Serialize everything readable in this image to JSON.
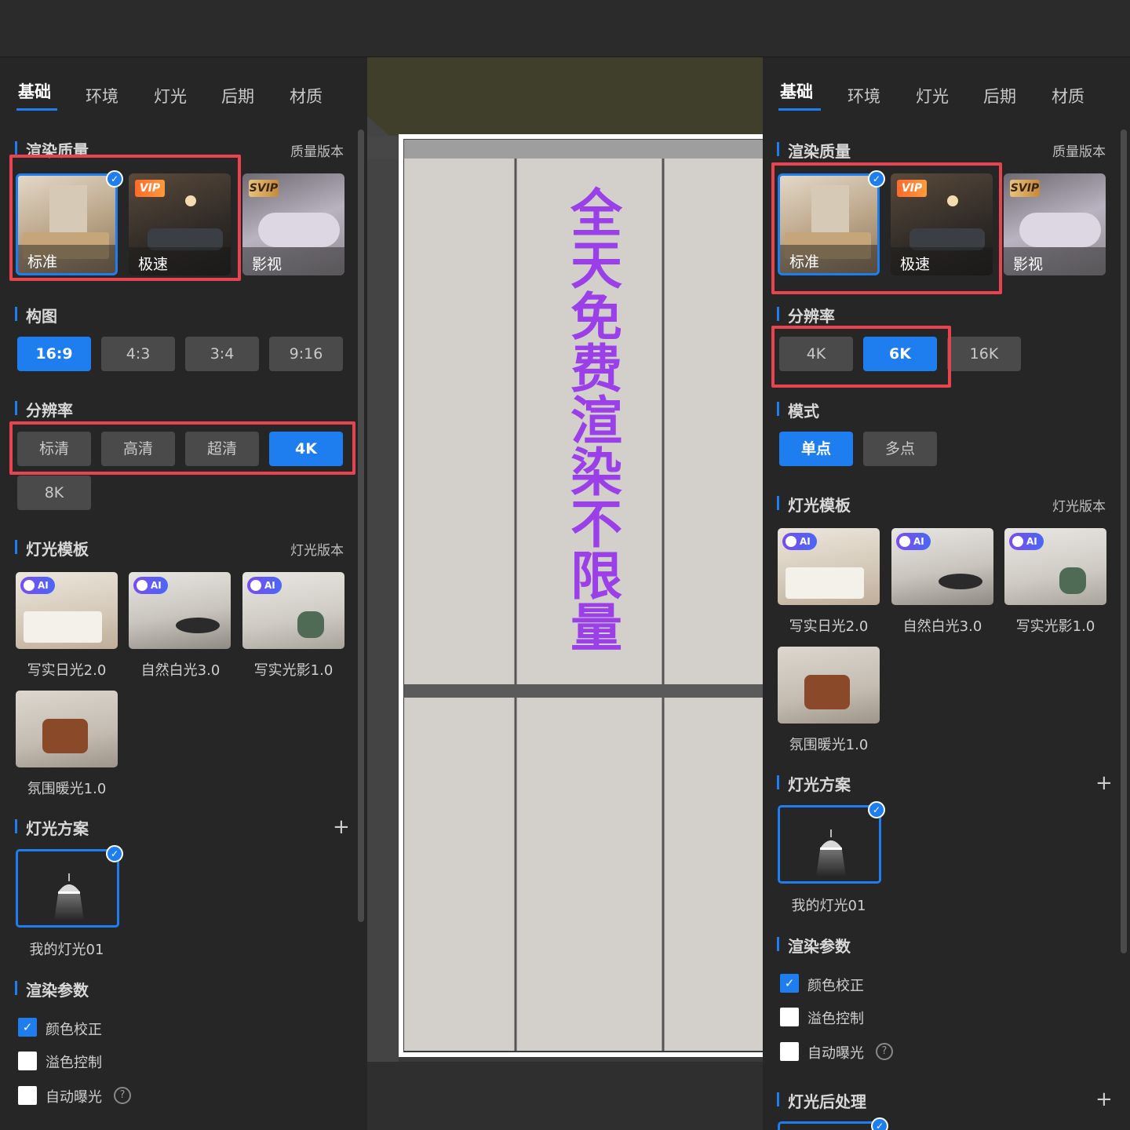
{
  "left_panel": {
    "tabs": [
      "基础",
      "环境",
      "灯光",
      "后期",
      "材质"
    ],
    "render_quality": {
      "title": "渲染质量",
      "right_link": "质量版本",
      "cards": [
        {
          "label": "标准",
          "badge": ""
        },
        {
          "label": "极速",
          "badge": "VIP"
        },
        {
          "label": "影视",
          "badge": "SVIP"
        }
      ]
    },
    "composition": {
      "title": "构图",
      "options": [
        "16:9",
        "4:3",
        "3:4",
        "9:16"
      ]
    },
    "resolution": {
      "title": "分辨率",
      "options": [
        "标清",
        "高清",
        "超清",
        "4K",
        "8K"
      ]
    },
    "light_template": {
      "title": "灯光模板",
      "right_link": "灯光版本",
      "ai_badge": "AI",
      "items": [
        "写实日光2.0",
        "自然白光3.0",
        "写实光影1.0",
        "氛围暖光1.0"
      ]
    },
    "light_scheme": {
      "title": "灯光方案",
      "plus": "+",
      "item": "我的灯光01"
    },
    "render_params": {
      "title": "渲染参数",
      "options": [
        "颜色校正",
        "溢色控制",
        "自动曝光"
      ],
      "help": "?"
    }
  },
  "right_panel": {
    "tabs": [
      "基础",
      "环境",
      "灯光",
      "后期",
      "材质"
    ],
    "render_quality": {
      "title": "渲染质量",
      "right_link": "质量版本",
      "cards": [
        {
          "label": "标准",
          "badge": ""
        },
        {
          "label": "极速",
          "badge": "VIP"
        },
        {
          "label": "影视",
          "badge": "SVIP"
        }
      ]
    },
    "resolution": {
      "title": "分辨率",
      "options": [
        "4K",
        "6K",
        "16K"
      ]
    },
    "mode": {
      "title": "模式",
      "options": [
        "单点",
        "多点"
      ]
    },
    "light_template": {
      "title": "灯光模板",
      "right_link": "灯光版本",
      "ai_badge": "AI",
      "items": [
        "写实日光2.0",
        "自然白光3.0",
        "写实光影1.0",
        "氛围暖光1.0"
      ]
    },
    "light_scheme": {
      "title": "灯光方案",
      "plus": "+",
      "item": "我的灯光01"
    },
    "render_params": {
      "title": "渲染参数",
      "options": [
        "颜色校正",
        "溢色控制",
        "自动曝光"
      ],
      "help": "?"
    },
    "light_post": {
      "title": "灯光后处理",
      "plus": "+"
    }
  },
  "promo_text": "全天免费渲染不限量",
  "check_mark": "✓",
  "colors": {
    "accent": "#1e7ef0",
    "highlight_box": "#e8434e",
    "promo": "#9b3fe8",
    "panel_bg": "#262626"
  }
}
